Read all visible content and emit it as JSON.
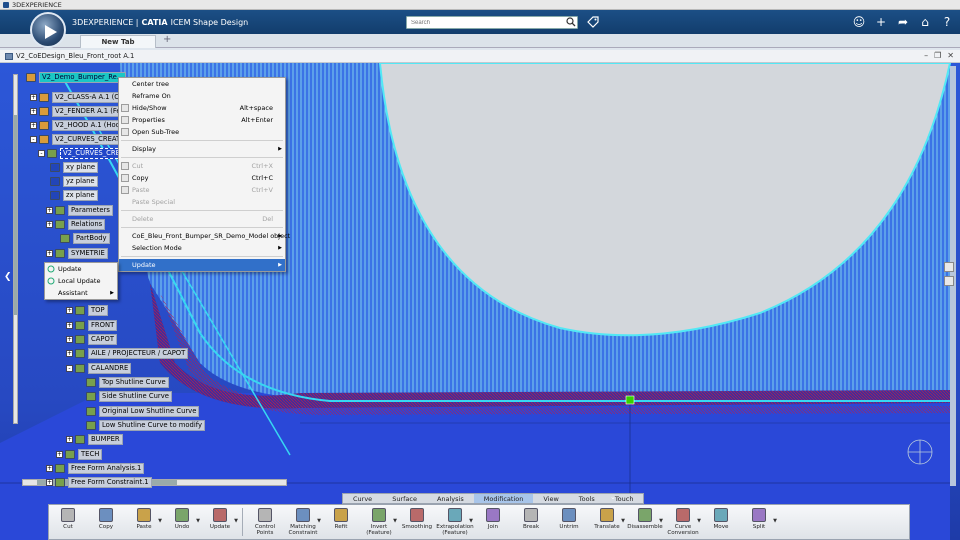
{
  "app": {
    "window_title": "3DEXPERIENCE",
    "brand_prefix": "3DEXPERIENCE |",
    "brand_app": "CATIA",
    "brand_suffix": "ICEM Shape Design",
    "search_placeholder": "Search"
  },
  "tabs": [
    {
      "label": "New Tab"
    }
  ],
  "tab_add": "+",
  "document": {
    "title": "V2_CoEDesign_Bleu_Front_root A.1"
  },
  "tree": {
    "root": "V2_Demo_Bumper_Re...",
    "items": [
      {
        "label": "V2_CLASS-A A.1 (Cl",
        "kind": "part",
        "exp": "+"
      },
      {
        "label": "V2_FENDER A.1 (Fe",
        "kind": "part",
        "exp": "+"
      },
      {
        "label": "V2_HOOD A.1 (Hoo",
        "kind": "part",
        "exp": "+"
      },
      {
        "label": "V2_CURVES_CREATI",
        "kind": "part",
        "exp": "-"
      },
      {
        "label": "V2_CURVES_CRE",
        "kind": "geo",
        "exp": "-"
      },
      {
        "label": "xy plane",
        "kind": "plane",
        "exp": ""
      },
      {
        "label": "yz plane",
        "kind": "plane",
        "exp": ""
      },
      {
        "label": "zx plane",
        "kind": "plane",
        "exp": ""
      },
      {
        "label": "Parameters",
        "kind": "geo",
        "exp": "+"
      },
      {
        "label": "Relations",
        "kind": "geo",
        "exp": "+"
      },
      {
        "label": "PartBody",
        "kind": "geo",
        "exp": ""
      },
      {
        "label": "SYMETRIE",
        "kind": "geo",
        "exp": "+"
      },
      {
        "label": "TOP",
        "kind": "geo",
        "exp": "+"
      },
      {
        "label": "FRONT",
        "kind": "geo",
        "exp": "+"
      },
      {
        "label": "CAPOT",
        "kind": "geo",
        "exp": "+"
      },
      {
        "label": "AILE / PROJECTEUR / CAPOT",
        "kind": "geo",
        "exp": "+"
      },
      {
        "label": "CALANDRE",
        "kind": "geo",
        "exp": "-"
      },
      {
        "label": "Top Shutline Curve",
        "kind": "geo",
        "exp": ""
      },
      {
        "label": "Side Shutline Curve",
        "kind": "geo",
        "exp": ""
      },
      {
        "label": "Original Low Shutline Curve",
        "kind": "geo",
        "exp": ""
      },
      {
        "label": "Low Shutline Curve to modify",
        "kind": "geo",
        "exp": ""
      },
      {
        "label": "BUMPER",
        "kind": "geo",
        "exp": "+"
      },
      {
        "label": "TECH",
        "kind": "geo",
        "exp": "+"
      },
      {
        "label": "Free Form Analysis.1",
        "kind": "geo",
        "exp": "+"
      },
      {
        "label": "Free Form Constraint.1",
        "kind": "geo",
        "exp": "+"
      }
    ]
  },
  "context_menu": {
    "items": [
      {
        "label": "Center tree",
        "shortcut": "",
        "disabled": false
      },
      {
        "label": "Reframe On",
        "shortcut": "",
        "disabled": false
      },
      {
        "label": "Hide/Show",
        "shortcut": "Alt+space",
        "disabled": false
      },
      {
        "label": "Properties",
        "shortcut": "Alt+Enter",
        "disabled": false
      },
      {
        "label": "Open Sub-Tree",
        "shortcut": "",
        "disabled": false
      },
      {
        "label": "Display",
        "shortcut": "",
        "disabled": false,
        "submenu": true
      },
      {
        "label": "Cut",
        "shortcut": "Ctrl+X",
        "disabled": true
      },
      {
        "label": "Copy",
        "shortcut": "Ctrl+C",
        "disabled": false
      },
      {
        "label": "Paste",
        "shortcut": "Ctrl+V",
        "disabled": true
      },
      {
        "label": "Paste Special",
        "shortcut": "",
        "disabled": true
      },
      {
        "label": "Delete",
        "shortcut": "Del",
        "disabled": true
      },
      {
        "label": "CoE_Bleu_Front_Bumper_SR_Demo_Model object",
        "shortcut": "",
        "disabled": false,
        "submenu": true
      },
      {
        "label": "Selection Mode",
        "shortcut": "",
        "disabled": false,
        "submenu": true
      },
      {
        "label": "Update",
        "shortcut": "",
        "disabled": false,
        "submenu": true,
        "active": true
      }
    ]
  },
  "sub_menu": {
    "items": [
      {
        "label": "Update"
      },
      {
        "label": "Local Update"
      },
      {
        "label": "Assistant",
        "submenu": true
      }
    ]
  },
  "section_tabs": [
    {
      "label": "Curve"
    },
    {
      "label": "Surface"
    },
    {
      "label": "Analysis"
    },
    {
      "label": "Modification",
      "active": true
    },
    {
      "label": "View"
    },
    {
      "label": "Tools"
    },
    {
      "label": "Touch"
    }
  ],
  "action_bar": {
    "group1": [
      {
        "label": "Cut"
      },
      {
        "label": "Copy"
      },
      {
        "label": "Paste"
      },
      {
        "label": "Undo"
      },
      {
        "label": "Update"
      }
    ],
    "group2": [
      {
        "label": "Control Points"
      },
      {
        "label": "Matching Constraint"
      },
      {
        "label": "Refit"
      },
      {
        "label": "Invert (Feature)"
      },
      {
        "label": "Smoothing"
      },
      {
        "label": "Extrapolation (Feature)"
      },
      {
        "label": "Join"
      },
      {
        "label": "Break"
      },
      {
        "label": "Untrim"
      },
      {
        "label": "Translate"
      },
      {
        "label": "Disassemble"
      },
      {
        "label": "Curve Conversion"
      },
      {
        "label": "Move"
      },
      {
        "label": "Split"
      }
    ]
  },
  "colors": {
    "header": "#1c4f86",
    "viewport": "#2c57d8",
    "selection_highlight": "#1bc7c4",
    "menu_active": "#3170c9",
    "surface_hatch": "#8fe4f0"
  }
}
